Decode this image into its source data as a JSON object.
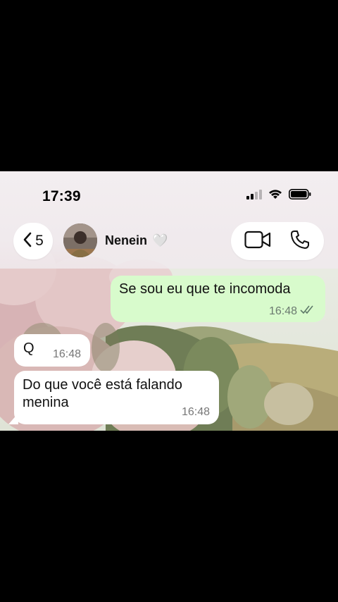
{
  "status_bar": {
    "time": "17:39"
  },
  "header": {
    "back_count": "5",
    "contact_name": "Nenein",
    "contact_heart": "🤍"
  },
  "messages": [
    {
      "direction": "outgoing",
      "text": "Se sou eu que te incomoda",
      "time": "16:48",
      "status": "read"
    },
    {
      "direction": "incoming",
      "text": "Q",
      "time": "16:48"
    },
    {
      "direction": "incoming",
      "text": "Do que você está falando menina",
      "time": "16:48"
    }
  ],
  "icons": {
    "back": "chevron-left-icon",
    "video": "video-camera-icon",
    "call": "phone-icon",
    "signal": "signal-icon",
    "wifi": "wifi-icon",
    "battery": "battery-icon",
    "read": "double-check-icon"
  },
  "colors": {
    "outgoing_bubble": "#d8fbcc",
    "incoming_bubble": "#ffffff",
    "header_bg": "#f0eaed"
  }
}
